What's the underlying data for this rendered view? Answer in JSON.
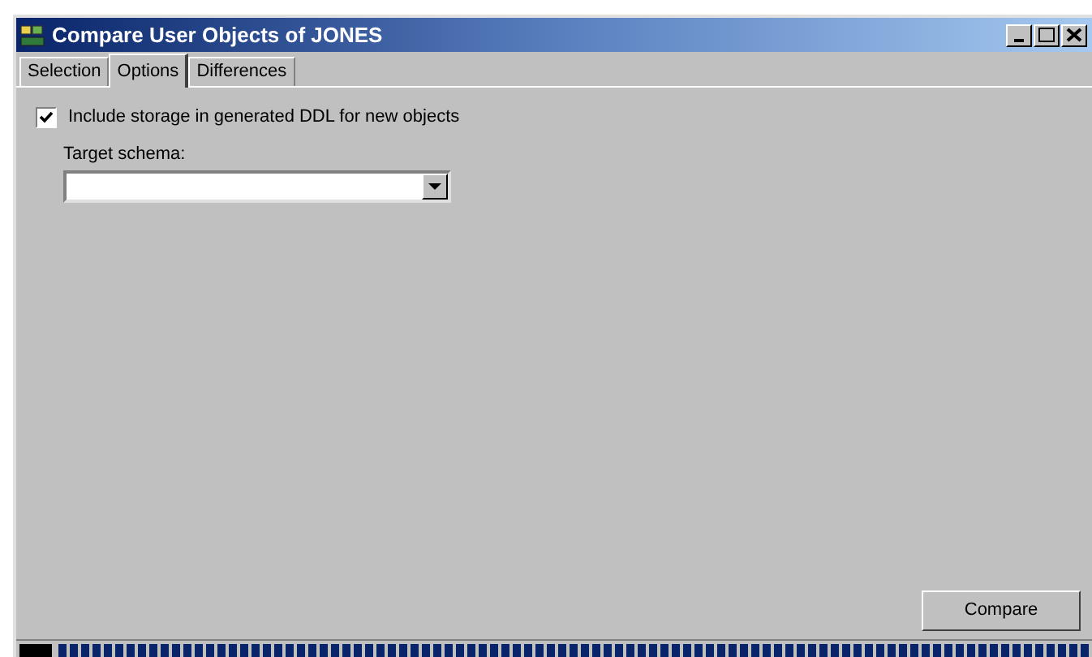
{
  "window": {
    "title": "Compare User Objects of JONES"
  },
  "tabs": [
    {
      "label": "Selection",
      "selected": false
    },
    {
      "label": "Options",
      "selected": true
    },
    {
      "label": "Differences",
      "selected": false
    }
  ],
  "options": {
    "include_storage": {
      "label": "Include storage in generated DDL for new objects",
      "checked": true
    },
    "target_schema": {
      "label": "Target schema:"
    }
  },
  "buttons": [
    {
      "label": "Compare"
    }
  ],
  "progress": {
    "level": 1
  }
}
